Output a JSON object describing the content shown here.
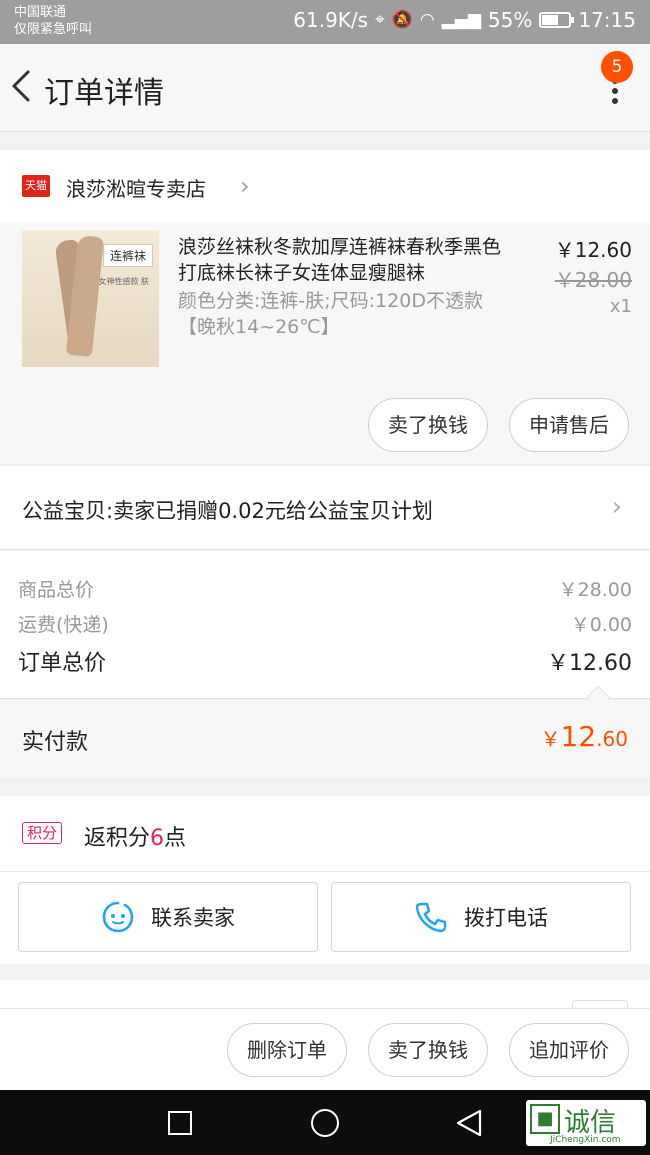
{
  "status_bar": {
    "carrier_line1": "中国联通",
    "carrier_line2": "仅限紧急呼叫",
    "net_speed": "61.9K/s",
    "battery": "55%",
    "time": "17:15"
  },
  "header": {
    "title": "订单详情",
    "notification_count": "5"
  },
  "shop": {
    "badge": "天猫",
    "name": "浪莎淞暄专卖店"
  },
  "product": {
    "image_tag": "连裤袜",
    "image_caption": "女神性感款 肤",
    "title": "浪莎丝袜秋冬款加厚连裤袜春秋季黑色打底袜长袜子女连体显瘦腿袜",
    "sku": "颜色分类:连裤-肤;尺码:120D不透款【晚秋14~26℃】",
    "price": "￥12.60",
    "original_price": "￥28.00",
    "quantity": "x1",
    "actions": [
      "卖了换钱",
      "申请售后"
    ]
  },
  "charity": {
    "text": "公益宝贝:卖家已捐赠0.02元给公益宝贝计划"
  },
  "summary": {
    "goods_total_label": "商品总价",
    "goods_total_value": "￥28.00",
    "shipping_label": "运费(快递)",
    "shipping_value": "￥0.00",
    "order_total_label": "订单总价",
    "order_total_value": "￥12.60"
  },
  "payment": {
    "label": "实付款",
    "currency": "￥",
    "amount_int": "12",
    "amount_dec": ".60"
  },
  "points": {
    "tag": "积分",
    "prefix": "返积分",
    "count": "6",
    "suffix": "点"
  },
  "contact": {
    "seller_label": "联系卖家",
    "phone_label": "拨打电话"
  },
  "bottom_actions": [
    "删除订单",
    "卖了换钱",
    "追加评价"
  ],
  "watermark": {
    "text": "诚信",
    "sub": "JiChengXin.com"
  },
  "colors": {
    "accent": "#ff5000",
    "tmall_red": "#e2231a",
    "points_pink": "#e0245e",
    "contact_blue": "#1aa3ff"
  }
}
